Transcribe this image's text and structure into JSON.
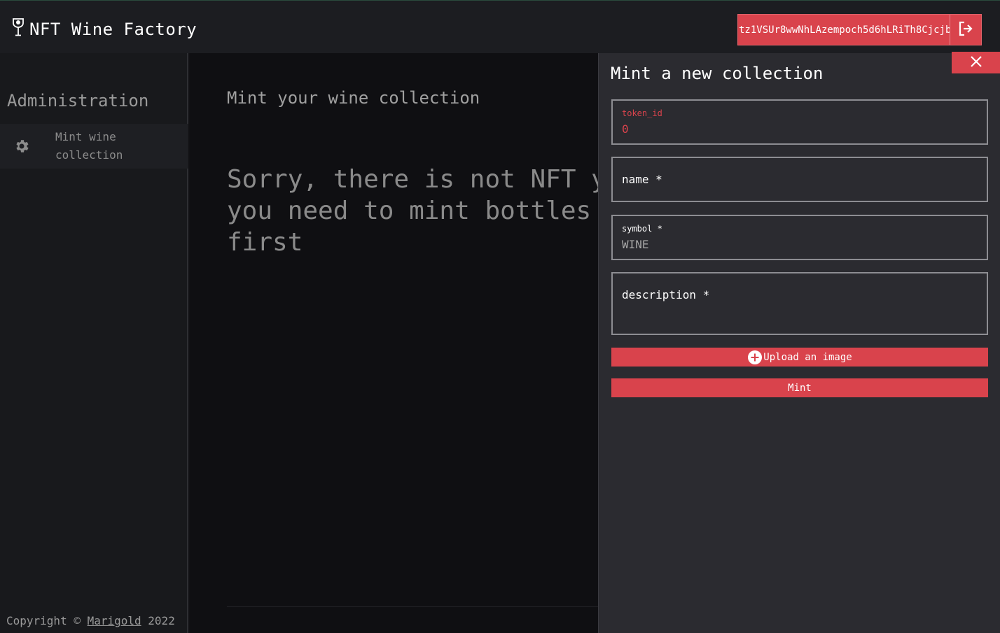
{
  "header": {
    "app_title": "NFT Wine Factory",
    "logo_icon": "wine-glass-icon",
    "wallet_address": "tz1VSUr8wwNhLAzempoch5d6hLRiTh8Cjcjb",
    "logout_icon": "logout-icon"
  },
  "sidebar": {
    "heading": "Administration",
    "items": [
      {
        "label": "Mint wine collection",
        "icon": "gear-icon"
      }
    ],
    "footer": {
      "prefix": "Copyright © ",
      "link": "Marigold",
      "suffix": " 2022"
    }
  },
  "main": {
    "title": "Mint your wine collection",
    "empty_message": "Sorry, there is not NFT yet, you need to mint bottles first"
  },
  "drawer": {
    "title": "Mint a new collection",
    "close_icon": "close-icon",
    "fields": {
      "token_id": {
        "label": "token_id",
        "value": "0"
      },
      "name": {
        "label": "name *"
      },
      "symbol": {
        "label": "symbol *",
        "value": "WINE"
      },
      "description": {
        "label": "description *"
      }
    },
    "upload_label": "Upload an image",
    "mint_label": "Mint"
  },
  "colors": {
    "accent": "#d9434c",
    "header_bg": "#1c1d21",
    "sidebar_bg": "#18191c",
    "main_bg": "#0f0f12",
    "drawer_bg": "#2b2b30"
  }
}
